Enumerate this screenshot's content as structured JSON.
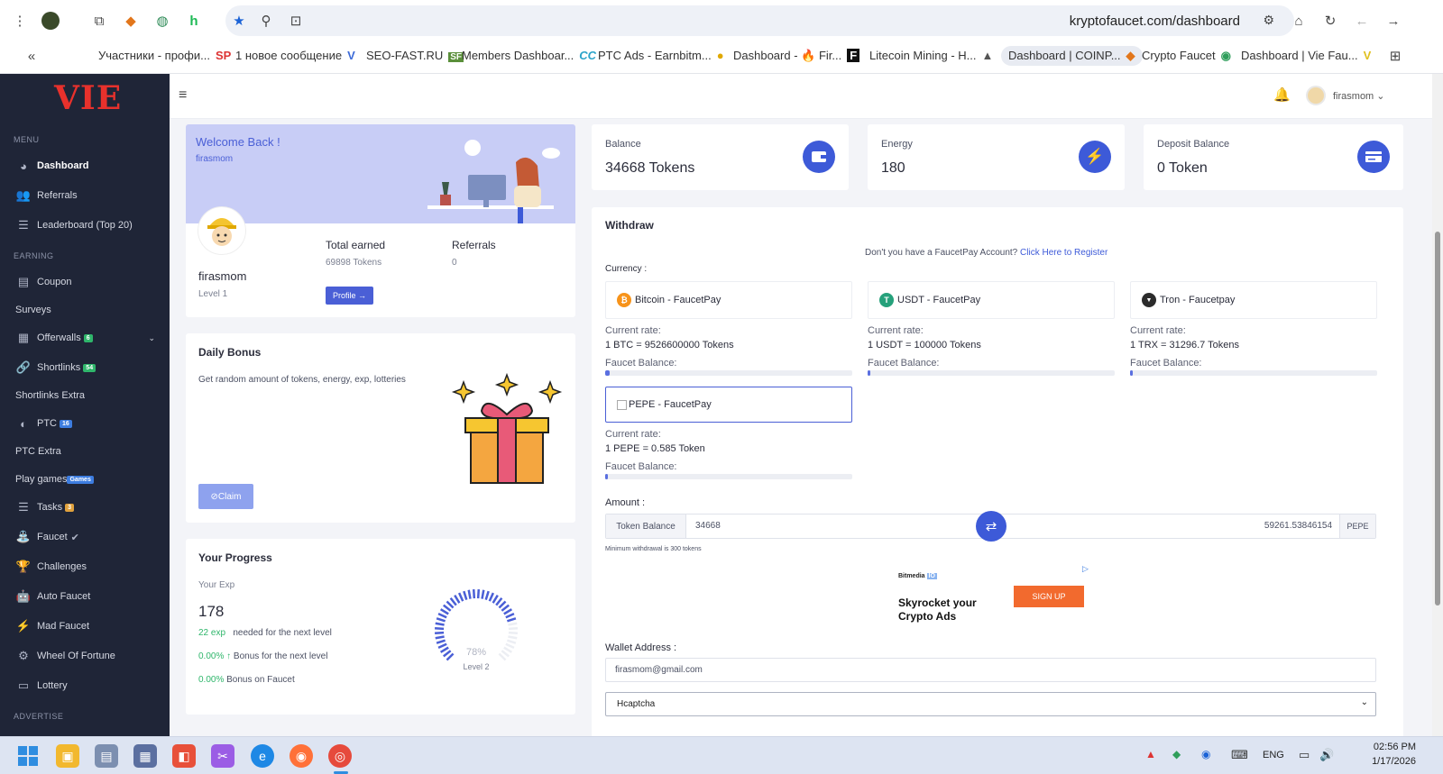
{
  "browser": {
    "url": "kryptofaucet.com/dashboard",
    "bookmarks": [
      {
        "label": "Участники - профи...",
        "icon": "SP"
      },
      {
        "label": "1 новое сообщение",
        "icon": "V"
      },
      {
        "label": "SEO-FAST.RU",
        "icon": "SF"
      },
      {
        "label": "Members Dashboar...",
        "icon": "CC"
      },
      {
        "label": "PTC Ads - Earnbitm...",
        "icon": "●"
      },
      {
        "label": "Dashboard - 🔥 Fir...",
        "icon": "F"
      },
      {
        "label": "Litecoin Mining - H...",
        "icon": "▲"
      },
      {
        "label": "Dashboard | COINP...",
        "icon": "◆"
      },
      {
        "label": "Crypto Faucet",
        "icon": "◉"
      },
      {
        "label": "Dashboard | Vie Fau...",
        "icon": "V"
      }
    ]
  },
  "sidebar": {
    "logo": "VIE",
    "menu_title": "MENU",
    "earning_title": "EARNING",
    "advertise_title": "ADVERTISE",
    "items": [
      {
        "label": "Dashboard",
        "icon": "dashboard-icon",
        "glyph": "◕"
      },
      {
        "label": "Referrals",
        "icon": "users-icon",
        "glyph": "👥"
      },
      {
        "label": "Leaderboard (Top 20)",
        "icon": "list-icon",
        "glyph": "☰"
      },
      {
        "label": "Coupon",
        "icon": "file-icon",
        "glyph": "▤"
      },
      {
        "label": "Surveys",
        "icon": "",
        "glyph": ""
      },
      {
        "label": "Offerwalls",
        "icon": "offerwall-icon",
        "glyph": "▦",
        "badge": "6",
        "badge_color": "#2fb66b"
      },
      {
        "label": "Shortlinks",
        "icon": "link-icon",
        "glyph": "🔗",
        "badge": "54",
        "badge_color": "#2fb66b"
      },
      {
        "label": "Shortlinks Extra",
        "icon": "",
        "glyph": ""
      },
      {
        "label": "PTC",
        "icon": "ptc-icon",
        "glyph": "◐",
        "badge": "16",
        "badge_color": "#3d7de0"
      },
      {
        "label": "PTC Extra",
        "icon": "",
        "glyph": ""
      },
      {
        "label": "Play games",
        "icon": "",
        "glyph": "",
        "badge": "Games",
        "badge_color": "#3d7de0"
      },
      {
        "label": "Tasks",
        "icon": "tasks-icon",
        "glyph": "☰",
        "badge": "3",
        "badge_color": "#e0a13d"
      },
      {
        "label": "Faucet",
        "icon": "faucet-icon",
        "glyph": "⛲"
      },
      {
        "label": "Challenges",
        "icon": "trophy-icon",
        "glyph": "🏆"
      },
      {
        "label": "Auto Faucet",
        "icon": "robot-icon",
        "glyph": "🤖"
      },
      {
        "label": "Mad Faucet",
        "icon": "bolt-icon",
        "glyph": "⚡"
      },
      {
        "label": "Wheel Of Fortune",
        "icon": "gear-icon",
        "glyph": "⚙"
      },
      {
        "label": "Lottery",
        "icon": "ticket-icon",
        "glyph": "▭"
      }
    ]
  },
  "topbar": {
    "username": "firasmom"
  },
  "welcome": {
    "title": "Welcome Back !",
    "username": "firasmom",
    "name": "firasmom",
    "level": "Level 1",
    "total_earned_label": "Total earned",
    "total_earned_value": "69898 Tokens",
    "referrals_label": "Referrals",
    "referrals_value": "0",
    "profile_button": "Profile"
  },
  "daily_bonus": {
    "title": "Daily Bonus",
    "text": "Get random amount of tokens, energy, exp, lotteries",
    "claim": "Claim"
  },
  "progress": {
    "title": "Your Progress",
    "exp_label": "Your Exp",
    "exp_value": "178",
    "needed_amount": "22 exp",
    "needed_text": "needed for the next level",
    "bonus_next_value": "0.00% ↑",
    "bonus_next_text": "Bonus for the next level",
    "bonus_faucet_value": "0.00%",
    "bonus_faucet_text": "Bonus on Faucet",
    "percent_label": "78%",
    "percent": 78,
    "level_label": "Level 2"
  },
  "stats": [
    {
      "label": "Balance",
      "value": "34668 Tokens",
      "icon": "wallet-icon",
      "glyph": "▭"
    },
    {
      "label": "Energy",
      "value": "180",
      "icon": "bolt-icon",
      "glyph": "⚡"
    },
    {
      "label": "Deposit Balance",
      "value": "0 Token",
      "icon": "card-icon",
      "glyph": "▤"
    }
  ],
  "withdraw": {
    "title": "Withdraw",
    "faucetpay_prompt": "Don't you have a FaucetPay Account?",
    "faucetpay_link": "Click Here to Register",
    "currency_label": "Currency :",
    "rate_label": "Current rate:",
    "faucet_balance_label": "Faucet Balance:",
    "currencies": [
      {
        "name": "Bitcoin - FaucetPay",
        "rate": "1 BTC = 9526600000 Tokens",
        "color": "#f7931a",
        "glyph": "₿",
        "fill": 0.02
      },
      {
        "name": "USDT - FaucetPay",
        "rate": "1 USDT = 100000 Tokens",
        "color": "#26a17b",
        "glyph": "T",
        "fill": 0.01
      },
      {
        "name": "Tron - Faucetpay",
        "rate": "1 TRX = 31296.7 Tokens",
        "color": "#2b2b2b",
        "glyph": "▼",
        "fill": 0.01
      },
      {
        "name": "PEPE - FaucetPay",
        "rate": "1 PEPE = 0.585 Token",
        "color": "",
        "glyph": "",
        "fill": 0.005
      }
    ],
    "amount_label": "Amount :",
    "token_balance_label": "Token Balance",
    "token_amount": "34668",
    "converted_amount": "59261.53846154",
    "converted_unit": "PEPE",
    "min_note": "Minimum withdrawal is 300 tokens",
    "ad": {
      "brand": "Bitmedia",
      "brand_tag": "IO",
      "headline_1": "Skyrocket your",
      "headline_2": "Crypto Ads",
      "cta": "SIGN UP"
    },
    "wallet_label": "Wallet Address :",
    "wallet_value": "firasmom@gmail.com",
    "captcha_value": "Hcaptcha"
  },
  "taskbar": {
    "lang": "ENG",
    "time": "02:56 PM",
    "date": "1/17/2026"
  }
}
